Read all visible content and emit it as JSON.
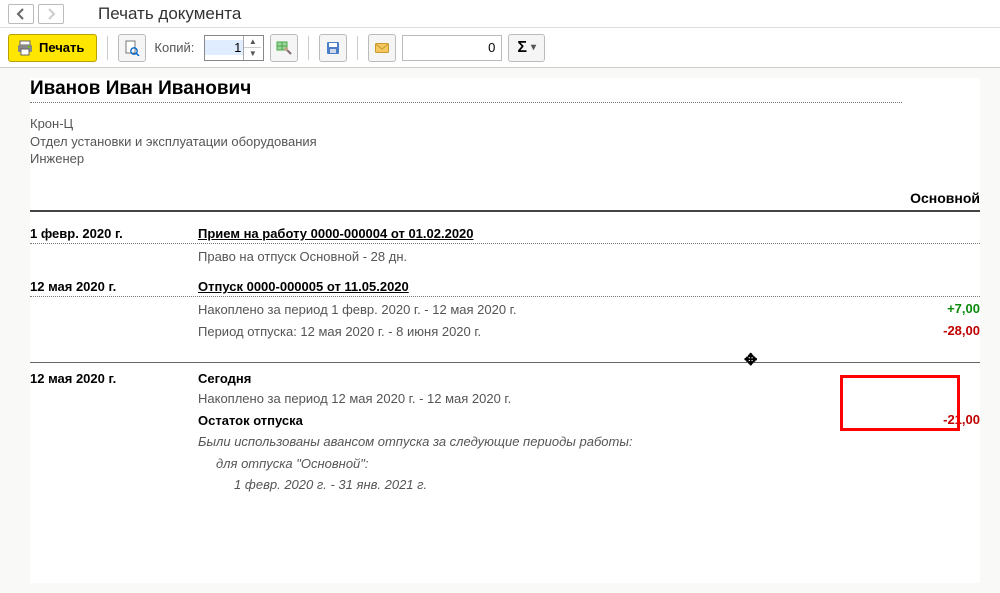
{
  "window": {
    "title": "Печать документа"
  },
  "toolbar": {
    "print_label": "Печать",
    "copies_label": "Копий:",
    "copies_value": "1",
    "num_field_value": "0",
    "sigma_label": "Σ"
  },
  "doc": {
    "employee_name": "Иванов Иван Иванович",
    "meta": {
      "org": "Крон-Ц",
      "dept": "Отдел установки и эксплуатации оборудования",
      "position": "Инженер"
    },
    "section_title": "Основной",
    "entries": {
      "e1": {
        "date": "1 февр. 2020 г.",
        "title": "Прием на работу 0000-000004 от 01.02.2020",
        "line1": "Право на отпуск Основной - 28 дн."
      },
      "e2": {
        "date": "12 мая 2020 г.",
        "title": "Отпуск 0000-000005 от 11.05.2020",
        "line1": "Накоплено за период 1 февр. 2020 г. - 12 мая 2020 г.",
        "line2": "Период отпуска: 12 мая 2020 г. - 8 июня 2020 г.",
        "val1": "+7,00",
        "val2": "-28,00"
      },
      "e3": {
        "date": "12 мая 2020 г.",
        "title": "Сегодня",
        "line1": "Накоплено за период 12 мая 2020 г. - 12 мая 2020 г.",
        "balance_label": "Остаток отпуска",
        "balance_val": "-21,00",
        "note_head": "Были использованы авансом отпуска за следующие периоды работы:",
        "note_sub": "для отпуска \"Основной\":",
        "note_period": "1 февр. 2020 г. - 31 янв. 2021 г."
      }
    }
  }
}
